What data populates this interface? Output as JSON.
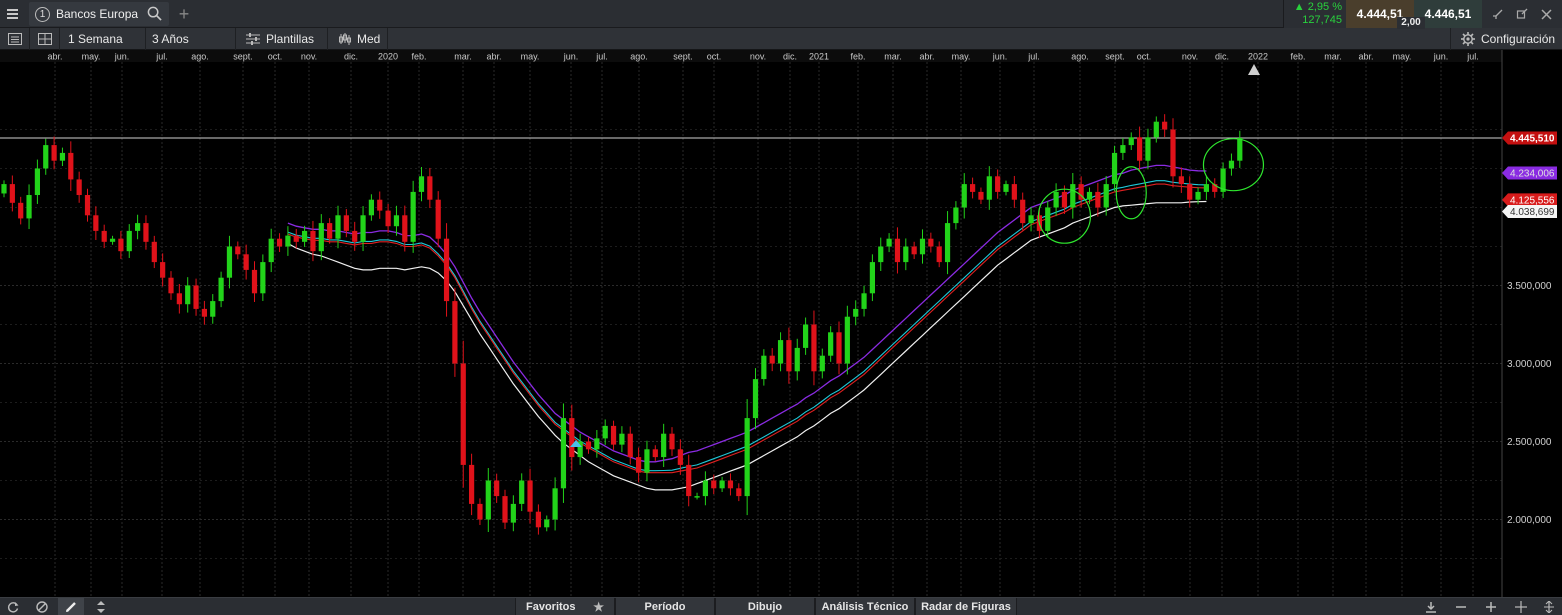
{
  "topbar": {
    "tab_number": "1",
    "tab_title": "Bancos Europa",
    "add_tab": "+",
    "change_pct": "▲ 2,95 %",
    "change_abs": "127,745",
    "bid": "4.444,51",
    "ask": "4.446,51",
    "spread": "2,00"
  },
  "toolbar": {
    "period": "1 Semana",
    "range": "3 Años",
    "templates": "Plantillas",
    "price_type": "Med",
    "config": "Configuración"
  },
  "bottombar": {
    "favorites": "Favoritos",
    "period": "Período",
    "drawing": "Dibujo",
    "technical_analysis": "Análisis Técnico",
    "pattern_radar": "Radar de Figuras"
  },
  "colors": {
    "up": "#22d31a",
    "down": "#e0121a",
    "ma_purple": "#8a2be2",
    "ma_cyan": "#1ec8d8",
    "ma_red": "#e02020",
    "ma_white": "#f0f0f0",
    "price_line": "#cfcfcf",
    "highlight_ellipse": "#2ee62e"
  },
  "chart_data": {
    "type": "candlestick",
    "instrument": "Bancos Europa",
    "timeframe": "1 Semana",
    "x_ticks": [
      "abr.",
      "may.",
      "jun.",
      "jul.",
      "ago.",
      "sept.",
      "oct.",
      "nov.",
      "dic.",
      "2020",
      "feb.",
      "mar.",
      "abr.",
      "may.",
      "jun.",
      "jul.",
      "ago.",
      "sept.",
      "oct.",
      "nov.",
      "dic.",
      "2021",
      "feb.",
      "mar.",
      "abr.",
      "may.",
      "jun.",
      "jul.",
      "ago.",
      "sept.",
      "oct.",
      "nov.",
      "dic.",
      "2022",
      "feb.",
      "mar.",
      "abr.",
      "may.",
      "jun.",
      "jul."
    ],
    "y_ticks": [
      "2.000,000",
      "2.500,000",
      "3.000,000",
      "3.500,000"
    ],
    "ylim": [
      1700,
      4800
    ],
    "grid": true,
    "current_price": 4445.51,
    "price_labels": [
      {
        "label": "4.445,510",
        "value": 4445.51,
        "kind": "price"
      },
      {
        "label": "4.234,006",
        "value": 4234.006,
        "kind": "ma_purple"
      },
      {
        "label": "4.125,556",
        "value": 4125.556,
        "kind": "ma_red"
      },
      {
        "label": "4.038,699",
        "value": 4038.699,
        "kind": "ma_white"
      }
    ],
    "closes": [
      4150,
      4030,
      3930,
      4080,
      4250,
      4400,
      4300,
      4350,
      4180,
      4080,
      3950,
      3850,
      3780,
      3800,
      3720,
      3850,
      3900,
      3780,
      3650,
      3550,
      3450,
      3380,
      3500,
      3350,
      3300,
      3400,
      3550,
      3750,
      3700,
      3600,
      3450,
      3650,
      3800,
      3750,
      3820,
      3780,
      3850,
      3720,
      3900,
      3800,
      3950,
      3850,
      3780,
      3950,
      4050,
      3980,
      3880,
      3950,
      3780,
      4100,
      4200,
      4050,
      3800,
      3400,
      3000,
      2350,
      2100,
      2000,
      2250,
      2150,
      1980,
      2100,
      2250,
      2050,
      1950,
      2000,
      2200,
      2650,
      2400,
      2500,
      2450,
      2520,
      2600,
      2480,
      2550,
      2400,
      2300,
      2450,
      2400,
      2550,
      2450,
      2350,
      2150,
      2150,
      2250,
      2200,
      2250,
      2200,
      2150,
      2650,
      2900,
      3050,
      3000,
      3150,
      2950,
      3100,
      3250,
      2950,
      3050,
      3200,
      3000,
      3300,
      3350,
      3450,
      3650,
      3750,
      3800,
      3650,
      3750,
      3700,
      3800,
      3750,
      3650,
      3900,
      4000,
      4150,
      4100,
      4050,
      4200,
      4100,
      4150,
      4050,
      3900,
      3950,
      3850,
      4000,
      4100,
      4000,
      4150,
      4050,
      4100,
      4000,
      4150,
      4350,
      4400,
      4450,
      4300,
      4450,
      4550,
      4500,
      4200,
      4150,
      4050,
      4100,
      4150,
      4100,
      4250,
      4300,
      4445.51
    ],
    "ma_purple": [
      null,
      null,
      null,
      null,
      null,
      null,
      null,
      null,
      null,
      null,
      null,
      null,
      null,
      null,
      null,
      null,
      null,
      null,
      null,
      null,
      null,
      null,
      null,
      null,
      null,
      null,
      null,
      null,
      null,
      null,
      null,
      null,
      null,
      null,
      3900,
      3880,
      3870,
      3860,
      3860,
      3850,
      3850,
      3840,
      3830,
      3840,
      3840,
      3850,
      3850,
      3840,
      3820,
      3820,
      3830,
      3810,
      3760,
      3700,
      3620,
      3520,
      3420,
      3330,
      3250,
      3170,
      3090,
      3010,
      2940,
      2870,
      2800,
      2740,
      2680,
      2640,
      2600,
      2560,
      2530,
      2500,
      2470,
      2440,
      2420,
      2400,
      2380,
      2370,
      2370,
      2380,
      2390,
      2410,
      2430,
      2440,
      2460,
      2480,
      2500,
      2520,
      2540,
      2560,
      2590,
      2620,
      2650,
      2680,
      2710,
      2740,
      2780,
      2810,
      2850,
      2890,
      2920,
      2960,
      3000,
      3040,
      3090,
      3140,
      3190,
      3240,
      3290,
      3340,
      3390,
      3440,
      3490,
      3540,
      3590,
      3640,
      3690,
      3740,
      3790,
      3840,
      3880,
      3920,
      3960,
      4000,
      4020,
      4040,
      4060,
      4080,
      4110,
      4130,
      4150,
      4170,
      4190,
      4210,
      4220,
      4240,
      4250,
      4260,
      4270,
      4270,
      4260,
      4250,
      4240,
      4235,
      4234
    ],
    "ma_red": [
      null,
      null,
      null,
      null,
      null,
      null,
      null,
      null,
      null,
      null,
      null,
      null,
      null,
      null,
      null,
      null,
      null,
      null,
      null,
      null,
      null,
      null,
      null,
      null,
      null,
      null,
      null,
      null,
      null,
      null,
      null,
      null,
      null,
      null,
      3830,
      3810,
      3800,
      3790,
      3790,
      3780,
      3780,
      3770,
      3760,
      3770,
      3770,
      3780,
      3780,
      3770,
      3750,
      3750,
      3760,
      3740,
      3690,
      3630,
      3550,
      3450,
      3350,
      3260,
      3180,
      3100,
      3020,
      2940,
      2870,
      2800,
      2730,
      2670,
      2610,
      2570,
      2530,
      2490,
      2460,
      2430,
      2400,
      2370,
      2350,
      2330,
      2310,
      2300,
      2300,
      2300,
      2300,
      2310,
      2320,
      2330,
      2350,
      2370,
      2390,
      2410,
      2430,
      2450,
      2480,
      2510,
      2540,
      2570,
      2600,
      2630,
      2670,
      2700,
      2740,
      2780,
      2810,
      2850,
      2890,
      2930,
      2980,
      3030,
      3080,
      3130,
      3180,
      3230,
      3280,
      3330,
      3380,
      3430,
      3480,
      3530,
      3580,
      3630,
      3680,
      3730,
      3770,
      3810,
      3850,
      3890,
      3910,
      3930,
      3950,
      3970,
      4000,
      4020,
      4040,
      4060,
      4080,
      4100,
      4110,
      4120,
      4130,
      4140,
      4150,
      4150,
      4140,
      4135,
      4130,
      4127,
      4125.556
    ],
    "ma_white": [
      null,
      null,
      null,
      null,
      null,
      null,
      null,
      null,
      null,
      null,
      null,
      null,
      null,
      null,
      null,
      null,
      null,
      null,
      null,
      null,
      null,
      null,
      null,
      null,
      null,
      null,
      null,
      null,
      null,
      null,
      null,
      null,
      null,
      null,
      3770,
      3740,
      3720,
      3700,
      3690,
      3670,
      3650,
      3630,
      3610,
      3600,
      3600,
      3610,
      3610,
      3610,
      3600,
      3610,
      3620,
      3610,
      3580,
      3530,
      3460,
      3370,
      3280,
      3190,
      3110,
      3030,
      2950,
      2870,
      2800,
      2730,
      2660,
      2600,
      2540,
      2490,
      2450,
      2410,
      2370,
      2340,
      2310,
      2280,
      2260,
      2240,
      2220,
      2200,
      2190,
      2190,
      2190,
      2200,
      2210,
      2230,
      2250,
      2270,
      2290,
      2310,
      2330,
      2350,
      2380,
      2410,
      2440,
      2470,
      2500,
      2530,
      2570,
      2600,
      2640,
      2680,
      2710,
      2750,
      2790,
      2830,
      2880,
      2930,
      2980,
      3030,
      3080,
      3130,
      3180,
      3230,
      3280,
      3330,
      3380,
      3430,
      3480,
      3530,
      3580,
      3630,
      3670,
      3710,
      3750,
      3790,
      3810,
      3830,
      3850,
      3870,
      3900,
      3920,
      3940,
      3960,
      3980,
      4000,
      4010,
      4015,
      4020,
      4025,
      4030,
      4030,
      4030,
      4030,
      4035,
      4037,
      4038.699
    ],
    "ellipse_highlights": [
      {
        "index": 127
      },
      {
        "index": 135
      },
      {
        "index": 147
      }
    ]
  }
}
